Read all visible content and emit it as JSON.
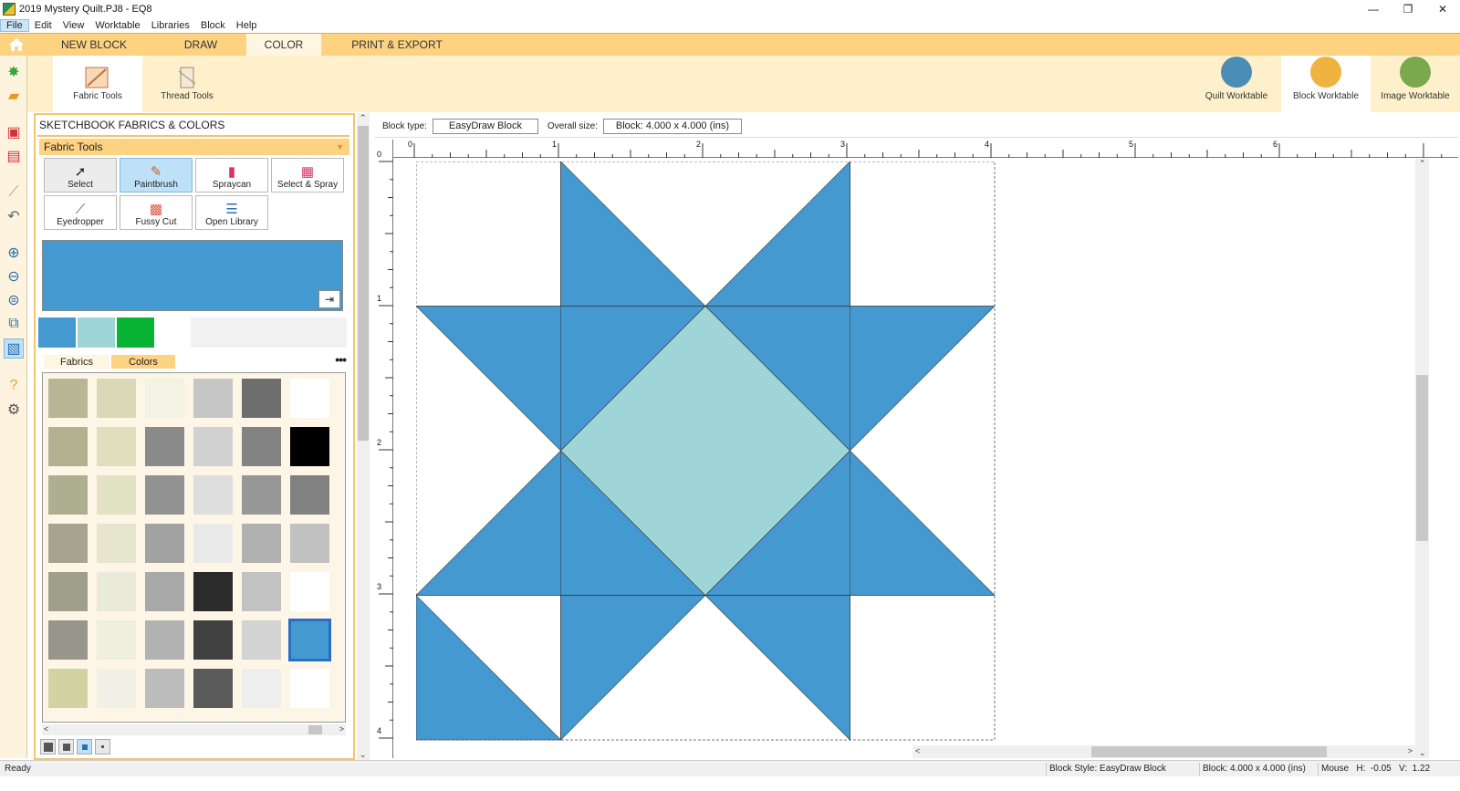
{
  "window": {
    "title": "2019 Mystery Quilt.PJ8 - EQ8",
    "min_glyph": "—",
    "restore_glyph": "❐",
    "close_glyph": "✕"
  },
  "menu": [
    "File",
    "Edit",
    "View",
    "Worktable",
    "Libraries",
    "Block",
    "Help"
  ],
  "ribbon": {
    "tabs": [
      "NEW BLOCK",
      "DRAW",
      "COLOR",
      "PRINT & EXPORT"
    ],
    "active_tab": "COLOR",
    "left_tools": [
      "Fabric Tools",
      "Thread Tools"
    ],
    "worktables": [
      "Quilt Worktable",
      "Block Worktable",
      "Image Worktable"
    ],
    "worktable_colors": [
      "#4a8db5",
      "#f0b340",
      "#7aa84a"
    ]
  },
  "panel": {
    "title": "SKETCHBOOK FABRICS & COLORS",
    "fabric_tools_header": "Fabric Tools",
    "tools": [
      "Select",
      "Paintbrush",
      "Spraycan",
      "Select & Spray",
      "Eyedropper",
      "Fussy Cut",
      "Open Library"
    ],
    "selected_tool": "Paintbrush",
    "preview_color": "#4499d1",
    "recent_swatches": [
      "#4499d1",
      "#a0d5d7",
      "#09b435"
    ],
    "sub_tabs": [
      "Fabrics",
      "Colors"
    ],
    "active_sub_tab": "Colors",
    "more_glyph": "•••",
    "palette": [
      [
        "#b7b796",
        "#d9d9b7",
        "#f2f2e5",
        "#c6c6c6",
        "#6e6e6e",
        "#ffffff"
      ],
      [
        "#b1b190",
        "#dfdfbd",
        "#8a8a8a",
        "#d1d1d1",
        "#838383",
        "#000000"
      ],
      [
        "#aeae91",
        "#e2e2c4",
        "#929292",
        "#dedede",
        "#979797",
        "#818181"
      ],
      [
        "#a6a48f",
        "#e6e6cf",
        "#a2a2a2",
        "#e9e9e9",
        "#b0b0b0",
        "#c1c1c1"
      ],
      [
        "#9f9f8b",
        "#eaeadb",
        "#a8a8a8",
        "#2b2b2b",
        "#c2c2c2",
        "#ffffff"
      ],
      [
        "#96968a",
        "#efefe0",
        "#b2b2b2",
        "#404040",
        "#d3d3d3",
        "#4499d1"
      ],
      [
        "#d2d2a2",
        "#f0f0e6",
        "#bcbcbc",
        "#5a5a5a",
        "#eeeeee",
        "#ffffff"
      ]
    ]
  },
  "infobar": {
    "block_type_label": "Block type:",
    "block_type_value": "EasyDraw Block",
    "overall_size_label": "Overall size:",
    "overall_size_value": "Block: 4.000 x 4.000 (ins)"
  },
  "ruler": {
    "top_labels": [
      "0",
      "1",
      "2",
      "3",
      "4",
      "5",
      "6"
    ],
    "left_labels": [
      "0",
      "1",
      "2",
      "3",
      "4"
    ]
  },
  "block": {
    "colors": {
      "blue": "#4499d1",
      "aqua": "#a0d5d7",
      "white": "#ffffff"
    }
  },
  "status": {
    "ready": "Ready",
    "block_style": "Block Style: EasyDraw Block",
    "block_size": "Block: 4.000 x 4.000 (ins)",
    "mouse": "Mouse   H:  -0.05   V:  1.22"
  }
}
